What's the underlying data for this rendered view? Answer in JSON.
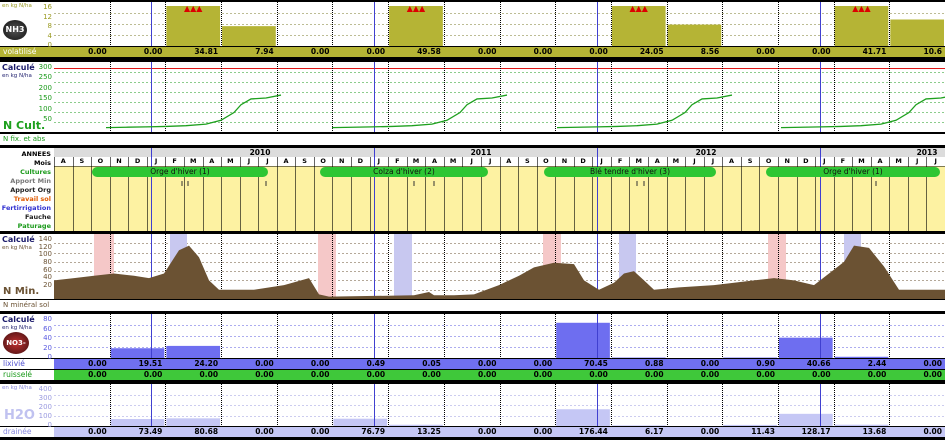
{
  "colors": {
    "volatilise": "#b5b435",
    "cult_line": "#1ea01e",
    "nmin": "#6b5233",
    "lixivie": "#6e6ef0",
    "water": "#c5c7f5",
    "green_row": "#3fc83a",
    "annees_bg": "#fdf2a2"
  },
  "nh3": {
    "unit": "en kg N/ha",
    "icon_text": "NH3",
    "ticks": [
      "16",
      "12",
      "8",
      "4",
      "0"
    ],
    "row_label": "volatilisé",
    "values": [
      "0.00",
      "0.00",
      "34.81",
      "7.94",
      "0.00",
      "0.00",
      "49.58",
      "0.00",
      "0.00",
      "0.00",
      "24.05",
      "8.56",
      "0.00",
      "0.00",
      "41.71",
      "10.6"
    ],
    "bars": [
      0,
      0,
      16,
      7.94,
      0,
      0,
      16,
      0,
      0,
      0,
      16,
      8.56,
      0,
      0,
      16,
      10.6
    ],
    "alerts": [
      2,
      6,
      10,
      14
    ],
    "alert_symbol": "▲▲▲"
  },
  "ncult": {
    "calc": "Calculé",
    "unit": "en kg N/ha",
    "ticks": [
      "300",
      "250",
      "200",
      "150",
      "100",
      "50"
    ],
    "big": "N Cult.",
    "sub": "N fix. et abs",
    "series": [
      [
        0,
        5
      ],
      [
        10,
        10
      ],
      [
        20,
        13
      ],
      [
        30,
        22
      ],
      [
        40,
        55
      ],
      [
        50,
        60
      ],
      [
        60,
        100
      ],
      [
        70,
        120
      ],
      [
        80,
        140
      ],
      [
        90,
        150
      ],
      [
        100,
        175
      ],
      [
        110,
        190
      ],
      [
        120,
        202
      ],
      [
        130,
        208
      ],
      [
        140,
        215
      ],
      [
        150,
        218
      ],
      [
        160,
        222
      ],
      [
        170,
        228
      ],
      [
        180,
        232
      ],
      [
        190,
        236
      ],
      [
        200,
        242
      ],
      [
        210,
        250
      ],
      [
        220,
        260
      ],
      [
        230,
        282
      ],
      [
        240,
        305
      ],
      [
        250,
        320
      ],
      [
        260,
        330
      ],
      [
        270,
        335
      ],
      [
        280,
        340
      ]
    ]
  },
  "annees": {
    "title": "ANNEES",
    "labels": [
      "Mois",
      "Cultures",
      "Apport Min",
      "Apport Org",
      "Travail sol",
      "Fertirrigation",
      "Fauche",
      "Paturage"
    ],
    "label_colors": [
      "#000",
      "#1a9a1a",
      "#777",
      "#222",
      "#e05a00",
      "#3030d0",
      "#222",
      "#1a9a1a"
    ],
    "years": [
      {
        "t": "2010",
        "x": 6
      },
      {
        "t": "2011",
        "x": 227
      },
      {
        "t": "2012",
        "x": 452
      },
      {
        "t": "2013",
        "x": 673
      }
    ],
    "months": [
      "A",
      "S",
      "O",
      "N",
      "D",
      "J",
      "F",
      "M",
      "A",
      "M",
      "J",
      "J",
      "A",
      "S",
      "O",
      "N",
      "D",
      "J",
      "F",
      "M",
      "A",
      "M",
      "J",
      "J",
      "A",
      "S",
      "O",
      "N",
      "D",
      "J",
      "F",
      "M",
      "A",
      "M",
      "J",
      "J",
      "A",
      "S",
      "O",
      "N",
      "D",
      "J",
      "F",
      "M",
      "A",
      "M",
      "J",
      "J"
    ],
    "crops": [
      {
        "t": "Orge d'hiver (1)",
        "x": 38,
        "w": 176
      },
      {
        "t": "Colza d'hiver (2)",
        "x": 266,
        "w": 168
      },
      {
        "t": "Blé tendre d'hiver (3)",
        "x": 490,
        "w": 172
      },
      {
        "t": "Orge d'hiver (1)",
        "x": 712,
        "w": 174
      }
    ]
  },
  "nmin": {
    "calc": "Calculé",
    "unit": "en kg N/ha",
    "ticks": [
      "140",
      "120",
      "100",
      "80",
      "60",
      "40",
      "20"
    ],
    "big": "N Min.",
    "sub": "N minéral sol",
    "series": [
      [
        0,
        40
      ],
      [
        20,
        45
      ],
      [
        40,
        50
      ],
      [
        60,
        55
      ],
      [
        80,
        50
      ],
      [
        95,
        45
      ],
      [
        110,
        55
      ],
      [
        125,
        105
      ],
      [
        135,
        115
      ],
      [
        145,
        90
      ],
      [
        155,
        40
      ],
      [
        165,
        20
      ],
      [
        200,
        20
      ],
      [
        230,
        30
      ],
      [
        255,
        45
      ],
      [
        265,
        10
      ],
      [
        275,
        5
      ],
      [
        360,
        8
      ],
      [
        375,
        15
      ],
      [
        380,
        8
      ],
      [
        400,
        8
      ],
      [
        420,
        10
      ],
      [
        445,
        30
      ],
      [
        465,
        50
      ],
      [
        480,
        68
      ],
      [
        500,
        78
      ],
      [
        520,
        75
      ],
      [
        530,
        40
      ],
      [
        545,
        20
      ],
      [
        560,
        35
      ],
      [
        570,
        55
      ],
      [
        580,
        60
      ],
      [
        590,
        40
      ],
      [
        600,
        20
      ],
      [
        625,
        25
      ],
      [
        660,
        30
      ],
      [
        700,
        40
      ],
      [
        720,
        45
      ],
      [
        740,
        40
      ],
      [
        760,
        30
      ],
      [
        790,
        80
      ],
      [
        800,
        115
      ],
      [
        815,
        110
      ],
      [
        830,
        70
      ],
      [
        845,
        20
      ],
      [
        891,
        20
      ]
    ]
  },
  "no3": {
    "calc": "Calculé",
    "unit": "en kg N/ha",
    "ticks": [
      "80",
      "60",
      "40",
      "20",
      "0"
    ],
    "icon_text": "NO3-",
    "row1_label": "lixivié",
    "row2_label": "ruisselé",
    "lix": [
      "0.00",
      "19.51",
      "24.20",
      "0.00",
      "0.00",
      "0.49",
      "0.05",
      "0.00",
      "0.00",
      "70.45",
      "0.88",
      "0.00",
      "0.90",
      "40.66",
      "2.44",
      "0.00"
    ],
    "rui": [
      "0.00",
      "0.00",
      "0.00",
      "0.00",
      "0.00",
      "0.00",
      "0.00",
      "0.00",
      "0.00",
      "0.00",
      "0.00",
      "0.00",
      "0.00",
      "0.00",
      "0.00",
      "0.00"
    ],
    "bars": [
      0,
      19.51,
      24.2,
      0,
      0,
      0.49,
      0.05,
      0,
      0,
      70.45,
      0.88,
      0,
      0.9,
      40.66,
      2.44,
      0
    ]
  },
  "h2o": {
    "unit": "en kg N/ha",
    "ticks": [
      "400",
      "300",
      "200",
      "100",
      "0"
    ],
    "icon_text": "H2O",
    "row_label": "drainée",
    "values": [
      "0.00",
      "73.49",
      "80.68",
      "0.00",
      "0.00",
      "76.79",
      "13.25",
      "0.00",
      "0.00",
      "176.44",
      "6.17",
      "0.00",
      "11.43",
      "128.17",
      "13.68",
      "0.00"
    ],
    "bars": [
      0,
      73.49,
      80.68,
      0,
      0,
      76.79,
      13.25,
      0,
      0,
      176.44,
      6.17,
      0,
      11.43,
      128.17,
      13.68,
      0
    ]
  }
}
